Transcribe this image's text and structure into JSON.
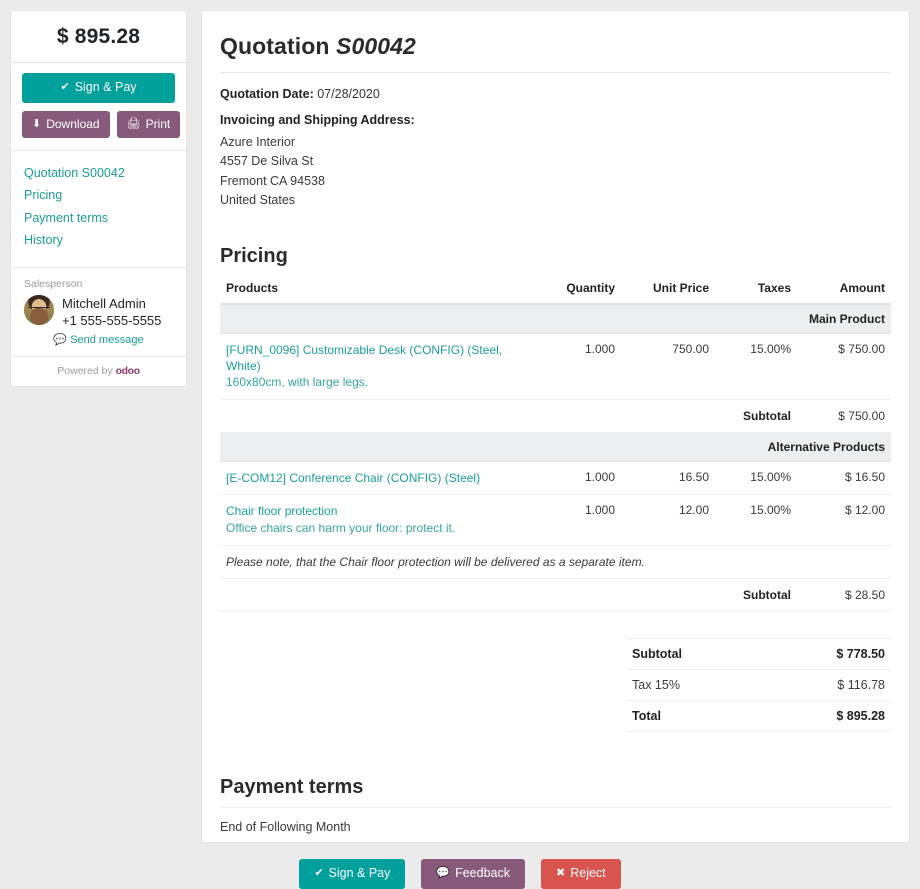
{
  "sidebar": {
    "amount": "$ 895.28",
    "sign_pay_label": "Sign & Pay",
    "sign_pay_icon": "check-icon",
    "download_label": "Download",
    "download_icon": "download-icon",
    "print_label": "Print",
    "print_icon": "printer-icon",
    "nav": [
      {
        "label": "Quotation S00042"
      },
      {
        "label": "Pricing"
      },
      {
        "label": "Payment terms"
      },
      {
        "label": "History"
      }
    ],
    "salesperson": {
      "section_label": "Salesperson",
      "name": "Mitchell Admin",
      "phone": "+1 555-555-5555",
      "message_label": "Send message",
      "message_icon": "comment-icon",
      "avatar_alt": "avatar"
    },
    "powered_by_prefix": "Powered by",
    "powered_by_brand": "odoo"
  },
  "main": {
    "title_prefix": "Quotation",
    "title_ref": "S00042",
    "quotation_date_label": "Quotation Date:",
    "quotation_date_value": "07/28/2020",
    "address_heading": "Invoicing and Shipping Address:",
    "address_lines": [
      "Azure Interior",
      "4557 De Silva St",
      "Fremont CA 94538",
      "United States"
    ],
    "pricing_heading": "Pricing",
    "table": {
      "headers": {
        "products": "Products",
        "quantity": "Quantity",
        "unit_price": "Unit Price",
        "taxes": "Taxes",
        "amount": "Amount"
      },
      "groups": [
        {
          "title": "Main Product",
          "rows": [
            {
              "name": "[FURN_0096] Customizable Desk (CONFIG) (Steel, White)",
              "description": "160x80cm, with large legs.",
              "quantity": "1.000",
              "unit_price": "750.00",
              "taxes": "15.00%",
              "amount": "$ 750.00"
            }
          ],
          "subtotal_label": "Subtotal",
          "subtotal_value": "$ 750.00"
        },
        {
          "title": "Alternative Products",
          "rows": [
            {
              "name": "[E-COM12] Conference Chair (CONFIG) (Steel)",
              "description": "",
              "quantity": "1.000",
              "unit_price": "16.50",
              "taxes": "15.00%",
              "amount": "$ 16.50"
            },
            {
              "name": "Chair floor protection",
              "description": "Office chairs can harm your floor: protect it.",
              "quantity": "1.000",
              "unit_price": "12.00",
              "taxes": "15.00%",
              "amount": "$ 12.00"
            }
          ],
          "note": "Please note, that the Chair floor protection will be delivered as a separate item.",
          "subtotal_label": "Subtotal",
          "subtotal_value": "$ 28.50"
        }
      ]
    },
    "totals": [
      {
        "label": "Subtotal",
        "value": "$ 778.50",
        "strong": true
      },
      {
        "label": "Tax 15%",
        "value": "$ 116.78",
        "strong": false
      },
      {
        "label": "Total",
        "value": "$ 895.28",
        "strong": true
      }
    ],
    "payment_terms_heading": "Payment terms",
    "payment_terms_text": "End of Following Month"
  },
  "footer": {
    "sign_pay_label": "Sign & Pay",
    "sign_pay_icon": "check-icon",
    "feedback_label": "Feedback",
    "feedback_icon": "comment-icon",
    "reject_label": "Reject",
    "reject_icon": "x-icon"
  },
  "colors": {
    "teal": "#00a09d",
    "purple": "#875a7b",
    "red": "#d9534f",
    "link": "#1a9e9a",
    "page_bg": "#ebebeb",
    "section_row_bg": "#eceeef"
  }
}
